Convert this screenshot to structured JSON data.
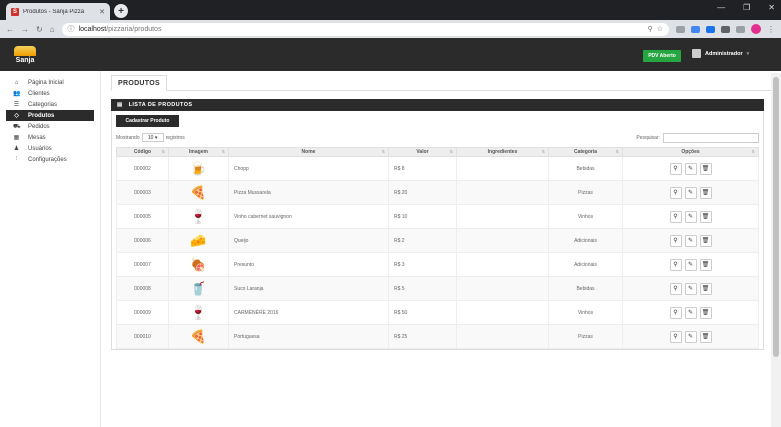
{
  "browser": {
    "tab_title": "Produtos - Sanja Pizza",
    "tab_favicon": "S",
    "url_host": "localhost",
    "url_path": "/pizzaria/produtos"
  },
  "topbar": {
    "logo_text": "Sanja",
    "pdv_label": "PDV Aberto",
    "user_label": "Administrador"
  },
  "sidebar": {
    "items": [
      {
        "label": "Página Inicial",
        "icon": "home-icon"
      },
      {
        "label": "Clientes",
        "icon": "users-icon"
      },
      {
        "label": "Categorias",
        "icon": "list-icon"
      },
      {
        "label": "Produtos",
        "icon": "tag-icon"
      },
      {
        "label": "Pedidos",
        "icon": "cart-icon"
      },
      {
        "label": "Mesas",
        "icon": "grid-icon"
      },
      {
        "label": "Usuários",
        "icon": "user-icon"
      },
      {
        "label": "Configurações",
        "icon": "sliders-icon"
      }
    ]
  },
  "page": {
    "tab_label": "PRODUTOS",
    "box_title": "LISTA DE PRODUTOS",
    "add_button": "Cadastrar Produto",
    "showing_prefix": "Mostrando",
    "page_length": "10",
    "showing_suffix": "registros",
    "search_label": "Pesquisar:"
  },
  "table": {
    "headers": [
      "Código",
      "Imagem",
      "Nome",
      "Valor",
      "Ingredientes",
      "Categoria",
      "Opções"
    ],
    "rows": [
      {
        "code": "000002",
        "image": "beer-mug-icon",
        "name": "Chopp",
        "price": "R$ 8",
        "ingredients": "",
        "category": "Bebidas"
      },
      {
        "code": "000003",
        "image": "pizza-icon",
        "name": "Pizza Mussarela",
        "price": "R$ 20",
        "ingredients": "",
        "category": "Pizzas"
      },
      {
        "code": "000005",
        "image": "wine-glass-icon",
        "name": "Vinho cabernet sauvignon",
        "price": "R$ 10",
        "ingredients": "",
        "category": "Vinhos"
      },
      {
        "code": "000006",
        "image": "cheese-icon",
        "name": "Queijo",
        "price": "R$ 2",
        "ingredients": "",
        "category": "Adicionais"
      },
      {
        "code": "000007",
        "image": "ham-icon",
        "name": "Presunto",
        "price": "R$ 3",
        "ingredients": "",
        "category": "Adicionais"
      },
      {
        "code": "000008",
        "image": "juice-cup-icon",
        "name": "Suco Laranja",
        "price": "R$ 5",
        "ingredients": "",
        "category": "Bebidas"
      },
      {
        "code": "000009",
        "image": "wine-glass-icon",
        "name": "CARMÉNÈRE 2016",
        "price": "R$ 50",
        "ingredients": "",
        "category": "Vinhos"
      },
      {
        "code": "000010",
        "image": "pizza-icon",
        "name": "Portuguesa",
        "price": "R$ 25",
        "ingredients": "",
        "category": "Pizzas"
      }
    ]
  },
  "colors": {
    "dark": "#2b2b2b",
    "pdv_green": "#26a641"
  }
}
